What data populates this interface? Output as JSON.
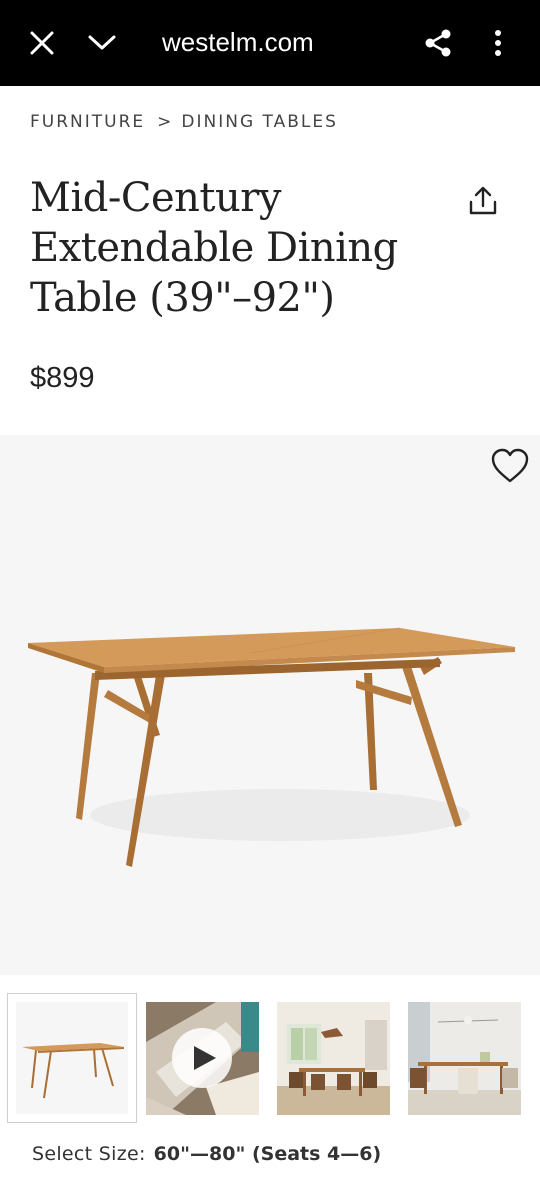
{
  "browser": {
    "url": "westelm.com",
    "icons": [
      "close-icon",
      "chevron-down-icon",
      "share-icon",
      "more-vertical-icon"
    ]
  },
  "breadcrumb": {
    "items": [
      "FURNITURE",
      "DINING TABLES"
    ],
    "separator": ">"
  },
  "product": {
    "title_lines": [
      "Mid-Century",
      "Extendable Dining",
      "Table (39\"–92\")"
    ],
    "price": "$899"
  },
  "gallery": {
    "thumbnails": [
      {
        "kind": "product-image",
        "active": true
      },
      {
        "kind": "video",
        "active": false
      },
      {
        "kind": "room-photo",
        "active": false
      },
      {
        "kind": "room-photo",
        "active": false
      }
    ]
  },
  "options": {
    "size_label": "Select Size:",
    "size_value": "60\"—80\" (Seats 4—6)"
  },
  "colors": {
    "topbar": "#000000",
    "wood": "#c48a4d",
    "wood_dark": "#a86e34",
    "hero_bg": "#f6f6f6"
  }
}
